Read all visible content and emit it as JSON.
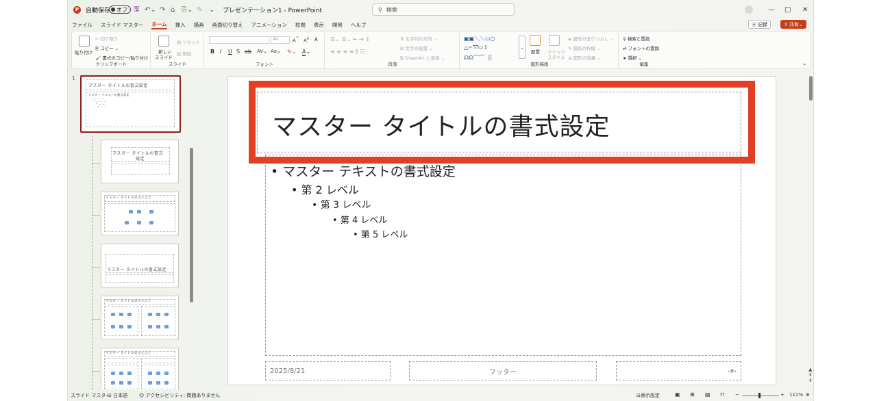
{
  "titlebar": {
    "autosave_label": "自動保存",
    "autosave_state": "オフ",
    "document_title": "プレゼンテーション1 - PowerPoint",
    "search_placeholder": "検索"
  },
  "tabs": [
    "ファイル",
    "スライド マスター",
    "ホーム",
    "挿入",
    "描画",
    "画面切り替え",
    "アニメーション",
    "校閲",
    "表示",
    "開発",
    "ヘルプ"
  ],
  "active_tab": "ホーム",
  "record_label": "記録",
  "share_label": "共有",
  "ribbon": {
    "clipboard": {
      "paste": "貼り付け",
      "cut": "切り取り",
      "copy": "コピー",
      "format_painter": "書式のコピー/貼り付け",
      "label": "クリップボード"
    },
    "slides": {
      "new_slide_1": "新しい",
      "new_slide_2": "スライド",
      "reset": "リセット",
      "delete": "削除",
      "label": "スライド"
    },
    "font": {
      "size": "44",
      "label": "フォント"
    },
    "paragraph": {
      "text_direction": "文字列の方向",
      "align_text": "文字の配置",
      "smartart": "SmartArt に変換",
      "label": "段落"
    },
    "drawing": {
      "arrange": "配置",
      "quick_styles_1": "クイック",
      "quick_styles_2": "スタイル",
      "shape_fill": "図形の塗りつぶし",
      "shape_outline": "図形の枠線",
      "shape_effects": "図形の効果",
      "label": "図形描画"
    },
    "editing": {
      "find": "検索と置換",
      "replace_font": "フォントの置換",
      "select": "選択",
      "label": "編集"
    }
  },
  "thumbnails": {
    "slide_number": "1",
    "master_title": "マスター タイトルの書式設定",
    "master_text": "マスター テキストの書式設定",
    "layout2_title_1": "マスター タイトルの書式",
    "layout2_title_2": "設定",
    "layout_title_short": "マスター タイトルの",
    "layout_title_gray": "書式設定"
  },
  "slide": {
    "title": "マスター タイトルの書式設定",
    "bullets": [
      "マスター テキストの書式設定",
      "第 2 レベル",
      "第 3 レベル",
      "第 4 レベル",
      "第 5 レベル"
    ],
    "date": "2025/8/21",
    "footer": "フッター",
    "page_number": "‹#›",
    "highlight_color": "#e23f25"
  },
  "statusbar": {
    "view": "スライド マスター",
    "language": "日本語",
    "accessibility": "アクセシビリティ: 問題ありません",
    "display_settings": "表示設定",
    "zoom": "111%"
  }
}
